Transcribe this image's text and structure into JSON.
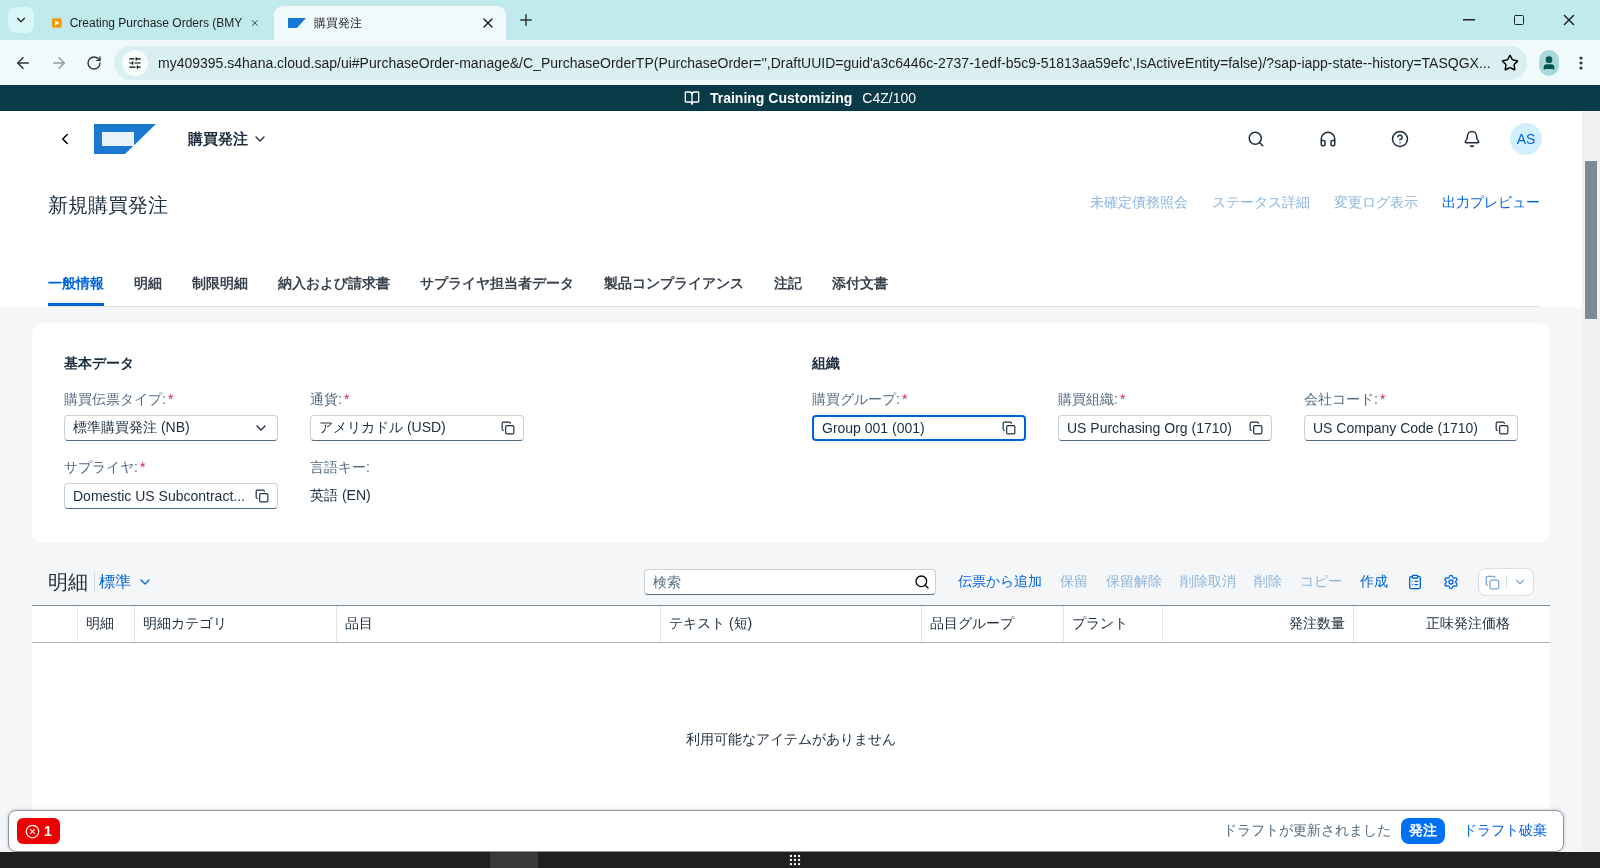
{
  "browser": {
    "tabs": [
      {
        "title": "Creating Purchase Orders (BMY",
        "kind": "video",
        "selected": false
      },
      {
        "title": "購買発注",
        "kind": "sap",
        "selected": true
      }
    ],
    "url": "my409395.s4hana.cloud.sap/ui#PurchaseOrder-manage&/C_PurchaseOrderTP(PurchaseOrder='',DraftUUID=guid'a3c6446c-2737-1edf-b5c9-51813aa59efc',IsActiveEntity=false)/?sap-iapp-state--history=TASQGX..."
  },
  "banner": {
    "title": "Training Customizing",
    "system": "C4Z/100"
  },
  "shell": {
    "app_title": "購買発注",
    "avatar": "AS"
  },
  "page": {
    "title": "新規購買発注",
    "actions": [
      {
        "label": "未確定債務照会",
        "disabled": true
      },
      {
        "label": "ステータス詳細",
        "disabled": true
      },
      {
        "label": "変更ログ表示",
        "disabled": true
      },
      {
        "label": "出力プレビュー",
        "disabled": false
      }
    ]
  },
  "section_tabs": [
    {
      "label": "一般情報",
      "selected": true
    },
    {
      "label": "明細",
      "selected": false
    },
    {
      "label": "制限明細",
      "selected": false
    },
    {
      "label": "納入および請求書",
      "selected": false
    },
    {
      "label": "サプライヤ担当者データ",
      "selected": false
    },
    {
      "label": "製品コンプライアンス",
      "selected": false
    },
    {
      "label": "注記",
      "selected": false
    },
    {
      "label": "添付文書",
      "selected": false
    }
  ],
  "form": {
    "groups": [
      {
        "title": "基本データ",
        "rows": [
          [
            {
              "label": "購買伝票タイプ:",
              "required_mark": "*",
              "kind": "select",
              "value": "標準購買発注 (NB)",
              "focused": false
            },
            {
              "label": "通貨:",
              "required_mark": "*",
              "kind": "valuehelp",
              "value": "アメリカドル (USD)",
              "focused": false
            }
          ],
          [
            {
              "label": "サプライヤ:",
              "required_mark": "*",
              "kind": "valuehelp",
              "value": "Domestic US Subcontract...",
              "focused": false
            },
            {
              "label": "言語キー:",
              "kind": "text",
              "value": "英語 (EN)"
            }
          ]
        ]
      },
      {
        "title": "組織",
        "rows": [
          [
            {
              "label": "購買グループ:",
              "required_mark": "*",
              "kind": "valuehelp",
              "value": "Group 001 (001)",
              "focused": true
            },
            {
              "label": "購買組織:",
              "required_mark": "*",
              "kind": "valuehelp",
              "value": "US Purchasing Org (1710)",
              "focused": false
            },
            {
              "label": "会社コード:",
              "required_mark": "*",
              "kind": "valuehelp",
              "value": "US Company Code (1710)",
              "focused": false
            }
          ]
        ]
      }
    ]
  },
  "items": {
    "title": "明細",
    "variant": "標準",
    "search": {
      "placeholder": "検索"
    },
    "actions": [
      {
        "label": "伝票から追加",
        "disabled": false
      },
      {
        "label": "保留",
        "disabled": true
      },
      {
        "label": "保留解除",
        "disabled": true
      },
      {
        "label": "削除取消",
        "disabled": true
      },
      {
        "label": "削除",
        "disabled": true
      },
      {
        "label": "コピー",
        "disabled": true
      },
      {
        "label": "作成",
        "disabled": false
      }
    ],
    "columns": [
      {
        "label": "明細",
        "kind": "text"
      },
      {
        "label": "明細カテゴリ",
        "kind": "text"
      },
      {
        "label": "品目",
        "kind": "text"
      },
      {
        "label": "テキスト (短)",
        "kind": "text"
      },
      {
        "label": "品目グループ",
        "kind": "text"
      },
      {
        "label": "プラント",
        "kind": "text"
      },
      {
        "label": "発注数量",
        "kind": "number"
      },
      {
        "label": "正味発注価格",
        "kind": "number"
      }
    ],
    "empty_text": "利用可能なアイテムがありません"
  },
  "footer": {
    "error_count": "1",
    "message": "ドラフトが更新されました",
    "buttons": [
      {
        "label": "発注",
        "kind": "emphasized"
      },
      {
        "label": "ドラフト破棄",
        "kind": "transparent"
      }
    ]
  }
}
